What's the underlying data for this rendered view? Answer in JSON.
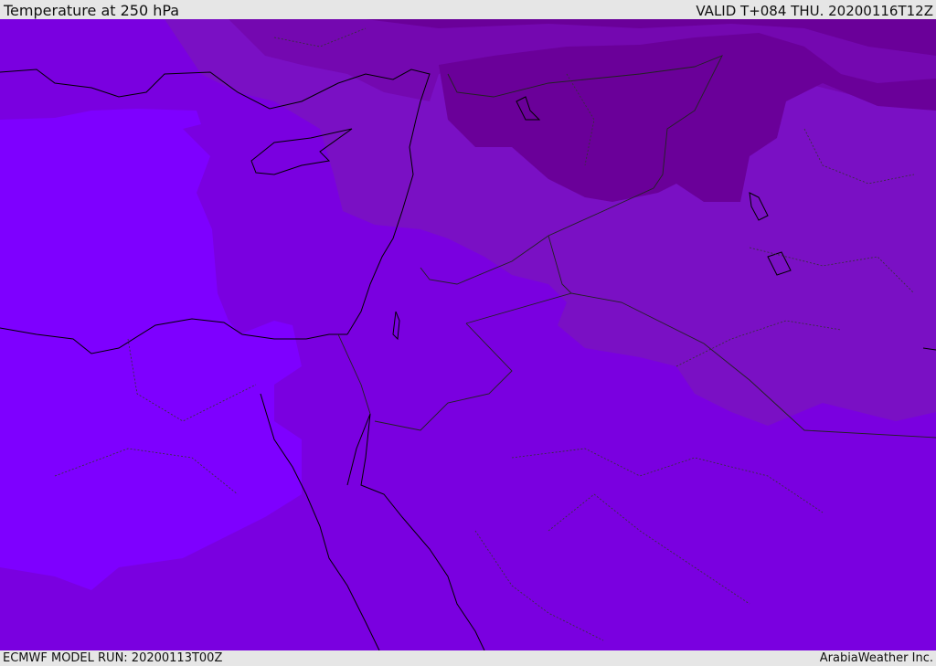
{
  "header": {
    "title": "Temperature at 250 hPa",
    "valid": "VALID T+084 THU. 20200116T12Z"
  },
  "footer": {
    "model_run": "ECMWF MODEL RUN: 20200113T00Z",
    "credit": "ArabiaWeather Inc."
  },
  "colors": {
    "band_warmest": "#7e00ff",
    "band_base": "#7a00e0",
    "band_cool": "#7a10c4",
    "band_colder": "#7408b0",
    "band_coldest": "#6a0099",
    "coast": "#000000",
    "border": "#222222"
  }
}
